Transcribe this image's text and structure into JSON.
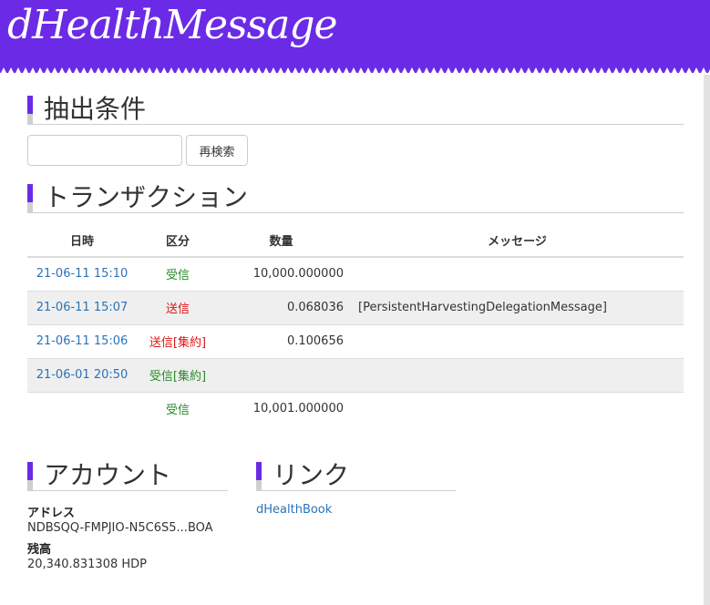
{
  "header": {
    "logo": "dHealthMessage",
    "colors": {
      "brand": "#6b2be6"
    }
  },
  "filter": {
    "title": "抽出条件",
    "input_value": "",
    "search_label": "再検索"
  },
  "transactions": {
    "title": "トランザクション",
    "columns": [
      "日時",
      "区分",
      "数量",
      "メッセージ"
    ],
    "rows": [
      {
        "date": "21-06-11 15:10",
        "kind": "受信",
        "amount": "10,000.000000",
        "message": ""
      },
      {
        "date": "21-06-11 15:07",
        "kind": "送信",
        "amount": "0.068036",
        "message": "[PersistentHarvestingDelegationMessage]"
      },
      {
        "date": "21-06-11 15:06",
        "kind": "送信[集約]",
        "amount": "0.100656",
        "message": ""
      },
      {
        "date": "21-06-01 20:50",
        "kind": "受信[集約]",
        "amount": "",
        "message": ""
      }
    ],
    "total": {
      "kind": "受信",
      "amount": "10,001.000000"
    },
    "colors": {
      "receive": "#2a8a2a",
      "send": "#e01515",
      "link": "#2a73b8"
    }
  },
  "account": {
    "title": "アカウント",
    "address_label": "アドレス",
    "address": "NDBSQQ-FMPJIO-N5C6S5...BOA",
    "balance_label": "残高",
    "balance": "20,340.831308 HDP"
  },
  "links": {
    "title": "リンク",
    "items": [
      "dHealthBook"
    ]
  }
}
